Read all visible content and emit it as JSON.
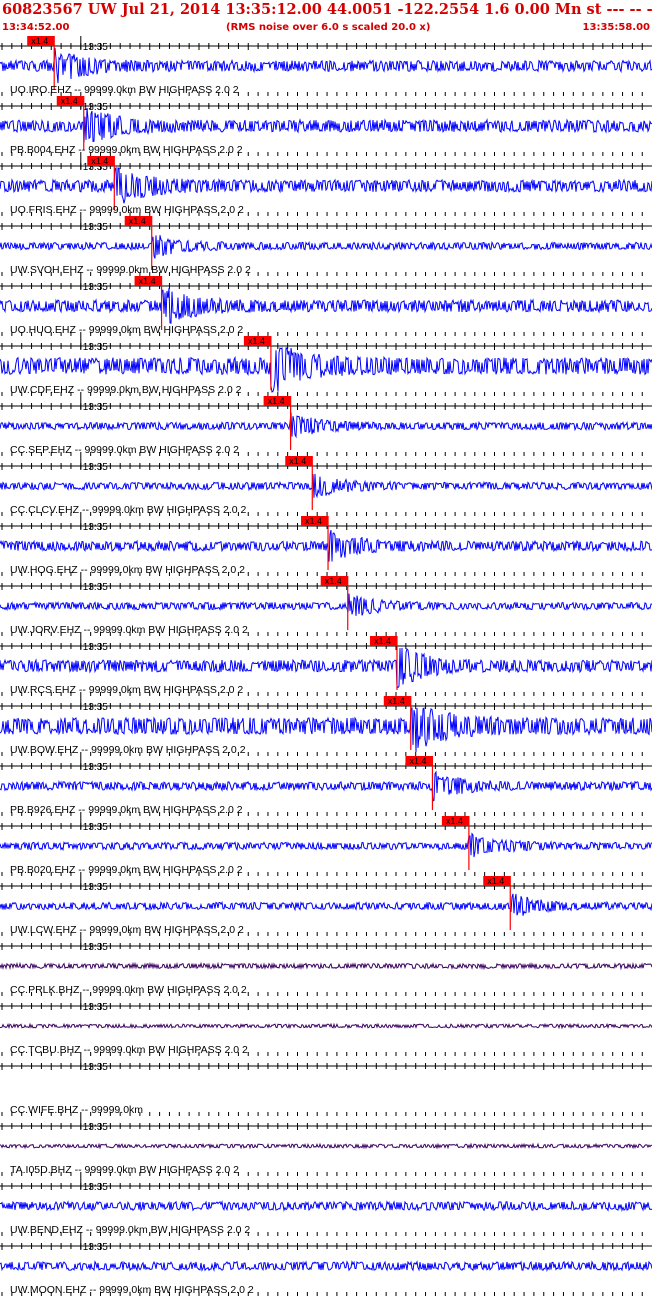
{
  "header": {
    "title": "60823567 UW Jul 21, 2014 13:35:12.00   44.0051 -122.2554  1.6 0.00 Mn st --- -- --  -1",
    "start_time": "13:34:52.00",
    "note": "(RMS noise over 6.0 s scaled 20.0 x)",
    "end_time": "13:35:58.00"
  },
  "minute_label": "13:35",
  "pick_label": "x1.4",
  "colors": {
    "header": "#d40000",
    "trace": "#0000ff",
    "broadband": "#3a0060",
    "pick": "#ff0000",
    "grid": "#000000"
  },
  "chart_data": {
    "type": "line",
    "title": "60823567 UW Jul 21, 2014 13:35:12.00   44.0051 -122.2554  1.6 0.00 Mn st --- -- --  -1",
    "x_range_seconds": [
      0,
      66
    ],
    "minute_mark_s": 8,
    "tick_interval_s": 1,
    "gain": "x1.4",
    "stations": [
      {
        "label": "UO.IRO.EHZ -- 99999.0km BW  HIGHPASS  2.0  2",
        "pick_s": 5.3,
        "amp": 0.45,
        "color": "blue"
      },
      {
        "label": "PB.B004.EHZ -- 99999.0km BW  HIGHPASS  2.0  2",
        "pick_s": 8.3,
        "amp": 0.5,
        "color": "blue"
      },
      {
        "label": "UO.FRIS.EHZ -- 99999.0km BW  HIGHPASS  2.0  2",
        "pick_s": 11.4,
        "amp": 0.5,
        "color": "blue"
      },
      {
        "label": "UW.SVOH.EHZ -- 99999.0km BW  HIGHPASS  2.0  2",
        "pick_s": 15.2,
        "amp": 0.3,
        "color": "blue"
      },
      {
        "label": "UO.HUO.EHZ -- 99999.0km BW  HIGHPASS  2.0  2",
        "pick_s": 16.2,
        "amp": 0.5,
        "color": "blue"
      },
      {
        "label": "UW.CDF.EHZ -- 99999.0km BW  HIGHPASS  2.0  2",
        "pick_s": 27.3,
        "amp": 0.7,
        "color": "blue"
      },
      {
        "label": "CC.SEP.EHZ -- 99999.0km BW  HIGHPASS  2.0  2",
        "pick_s": 29.3,
        "amp": 0.3,
        "color": "blue"
      },
      {
        "label": "CC.CLCV.EHZ -- 99999.0km BW  HIGHPASS  2.0  2",
        "pick_s": 31.5,
        "amp": 0.3,
        "color": "blue"
      },
      {
        "label": "UW.HOG.EHZ -- 99999.0km BW  HIGHPASS  2.0  2",
        "pick_s": 33.1,
        "amp": 0.4,
        "color": "blue"
      },
      {
        "label": "UW.JORV.EHZ -- 99999.0km BW  HIGHPASS  2.0  2",
        "pick_s": 35.1,
        "amp": 0.3,
        "color": "blue"
      },
      {
        "label": "UW.RCS.EHZ -- 99999.0km BW  HIGHPASS  2.0  2",
        "pick_s": 40.1,
        "amp": 0.5,
        "color": "blue"
      },
      {
        "label": "UW.BOW.EHZ -- 99999.0km BW  HIGHPASS  2.0  2",
        "pick_s": 41.5,
        "amp": 0.7,
        "color": "blue"
      },
      {
        "label": "PB.B926.EHZ -- 99999.0km BW  HIGHPASS  2.0  2",
        "pick_s": 43.7,
        "amp": 0.35,
        "color": "blue"
      },
      {
        "label": "PB.B020.EHZ -- 99999.0km BW  HIGHPASS  2.0  2",
        "pick_s": 47.4,
        "amp": 0.3,
        "color": "blue"
      },
      {
        "label": "UW.LCW.EHZ -- 99999.0km BW  HIGHPASS  2.0  2",
        "pick_s": 51.6,
        "amp": 0.3,
        "color": "blue"
      },
      {
        "label": "CC.PRLK.BHZ -- 99999.0km BW  HIGHPASS  2.0  2",
        "pick_s": null,
        "amp": 0.2,
        "color": "purple"
      },
      {
        "label": "CC.TCBU.BHZ -- 99999.0km BW  HIGHPASS  2.0  2",
        "pick_s": null,
        "amp": 0.15,
        "color": "purple"
      },
      {
        "label": "CC.WIFE.BHZ -- 99999.0km",
        "pick_s": null,
        "amp": 0,
        "color": "none"
      },
      {
        "label": "TA.I05D.BHZ -- 99999.0km BW  HIGHPASS  2.0  2",
        "pick_s": null,
        "amp": 0.15,
        "color": "purple"
      },
      {
        "label": "UW.BEND.EHZ -- 99999.0km BW  HIGHPASS  2.0  2",
        "pick_s": null,
        "amp": 0.35,
        "color": "blue"
      },
      {
        "label": "UW.MOON.EHZ -- 99999.0km BW  HIGHPASS  2.0  2",
        "pick_s": null,
        "amp": 0.35,
        "color": "blue"
      }
    ]
  }
}
